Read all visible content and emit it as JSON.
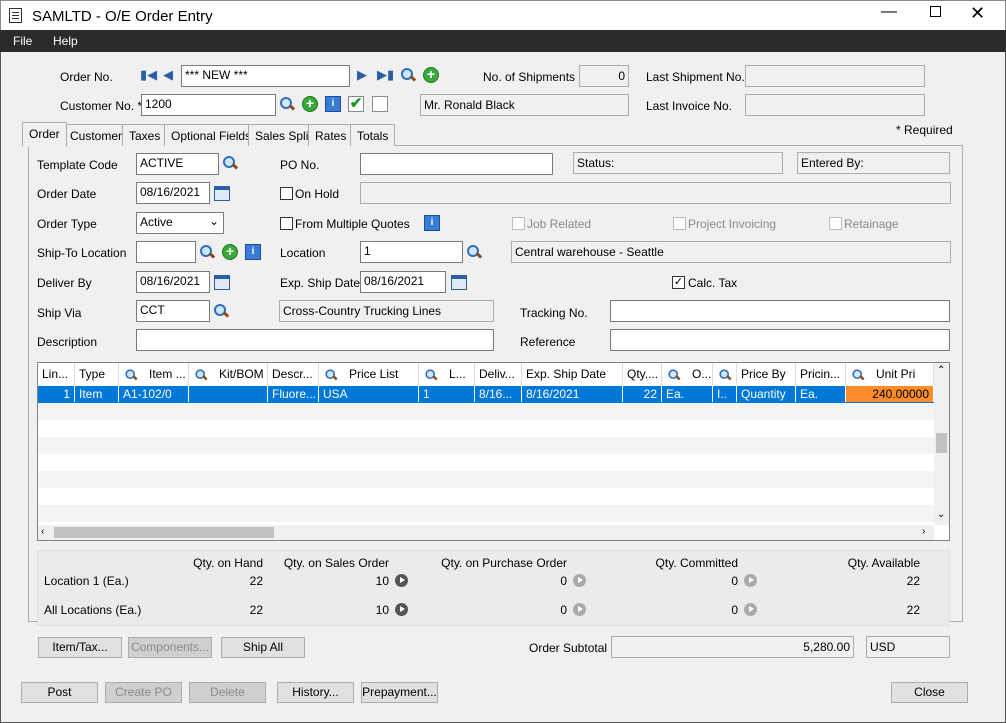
{
  "window": {
    "title": "SAMLTD - O/E Order Entry"
  },
  "menu": [
    "File",
    "Help"
  ],
  "header": {
    "order_no_label": "Order No.",
    "order_no": "*** NEW ***",
    "customer_no_label": "Customer No. *",
    "customer_no": "1200",
    "customer_name": "Mr. Ronald Black",
    "shipments_label": "No. of Shipments",
    "shipments": "0",
    "last_shipment_label": "Last Shipment No.",
    "last_shipment": "",
    "last_invoice_label": "Last Invoice No.",
    "last_invoice": "",
    "required_note": "*  Required"
  },
  "tabs": [
    "Order",
    "Customer",
    "Taxes",
    "Optional Fields",
    "Sales Split",
    "Rates",
    "Totals"
  ],
  "form": {
    "template_code_label": "Template Code",
    "template_code": "ACTIVE",
    "order_date_label": "Order Date",
    "order_date": "08/16/2021",
    "order_type_label": "Order Type",
    "order_type": "Active",
    "ship_to_label": "Ship-To Location",
    "ship_to": "",
    "deliver_by_label": "Deliver By",
    "deliver_by": "08/16/2021",
    "ship_via_label": "Ship Via",
    "ship_via": "CCT",
    "ship_via_desc": "Cross-Country Trucking Lines",
    "description_label": "Description",
    "description": "",
    "po_label": "PO No.",
    "po": "",
    "status_label": "Status:",
    "entered_by_label": "Entered By:",
    "on_hold_label": "On Hold",
    "multi_quotes_label": "From Multiple Quotes",
    "job_related_label": "Job Related",
    "project_invoicing_label": "Project Invoicing",
    "retainage_label": "Retainage",
    "location_label": "Location",
    "location": "1",
    "location_desc": "Central warehouse - Seattle",
    "exp_ship_label": "Exp. Ship Date",
    "exp_ship": "08/16/2021",
    "calc_tax_label": "Calc. Tax",
    "calc_tax": true,
    "tracking_label": "Tracking No.",
    "tracking": "",
    "reference_label": "Reference",
    "reference": ""
  },
  "grid": {
    "columns": [
      "Lin...",
      "Type",
      "Item ...",
      "Kit/BOM",
      "Descr...",
      "Price List",
      "L...",
      "Deliv...",
      "Exp. Ship Date",
      "Qty....",
      "O...",
      "",
      "Price By",
      "Pricin...",
      "Unit Pri"
    ],
    "rows": [
      [
        "1",
        "Item",
        "A1-102/0",
        "",
        "Fluore...",
        "USA",
        "1",
        "8/16...",
        "8/16/2021",
        "22",
        "Ea.",
        "I..",
        "Quantity",
        "Ea.",
        "240.00000"
      ]
    ]
  },
  "stock": {
    "headers": [
      "Qty. on Hand",
      "Qty. on Sales Order",
      "Qty. on Purchase Order",
      "Qty. Committed",
      "Qty. Available"
    ],
    "rows": [
      {
        "label": "Location  1 (Ea.)",
        "values": [
          "22",
          "10",
          "0",
          "0",
          "22"
        ]
      },
      {
        "label": "All Locations (Ea.)",
        "values": [
          "22",
          "10",
          "0",
          "0",
          "22"
        ]
      }
    ]
  },
  "buttons": {
    "item_tax": "Item/Tax...",
    "components": "Components...",
    "ship_all": "Ship All",
    "post": "Post",
    "create_po": "Create PO",
    "delete": "Delete",
    "history": "History...",
    "prepayment": "Prepayment...",
    "close": "Close"
  },
  "totals": {
    "subtotal_label": "Order Subtotal",
    "subtotal": "5,280.00",
    "currency": "USD"
  },
  "colors": {
    "selection": "#0078d7",
    "unit_price_highlight": "#ff8c2a"
  }
}
